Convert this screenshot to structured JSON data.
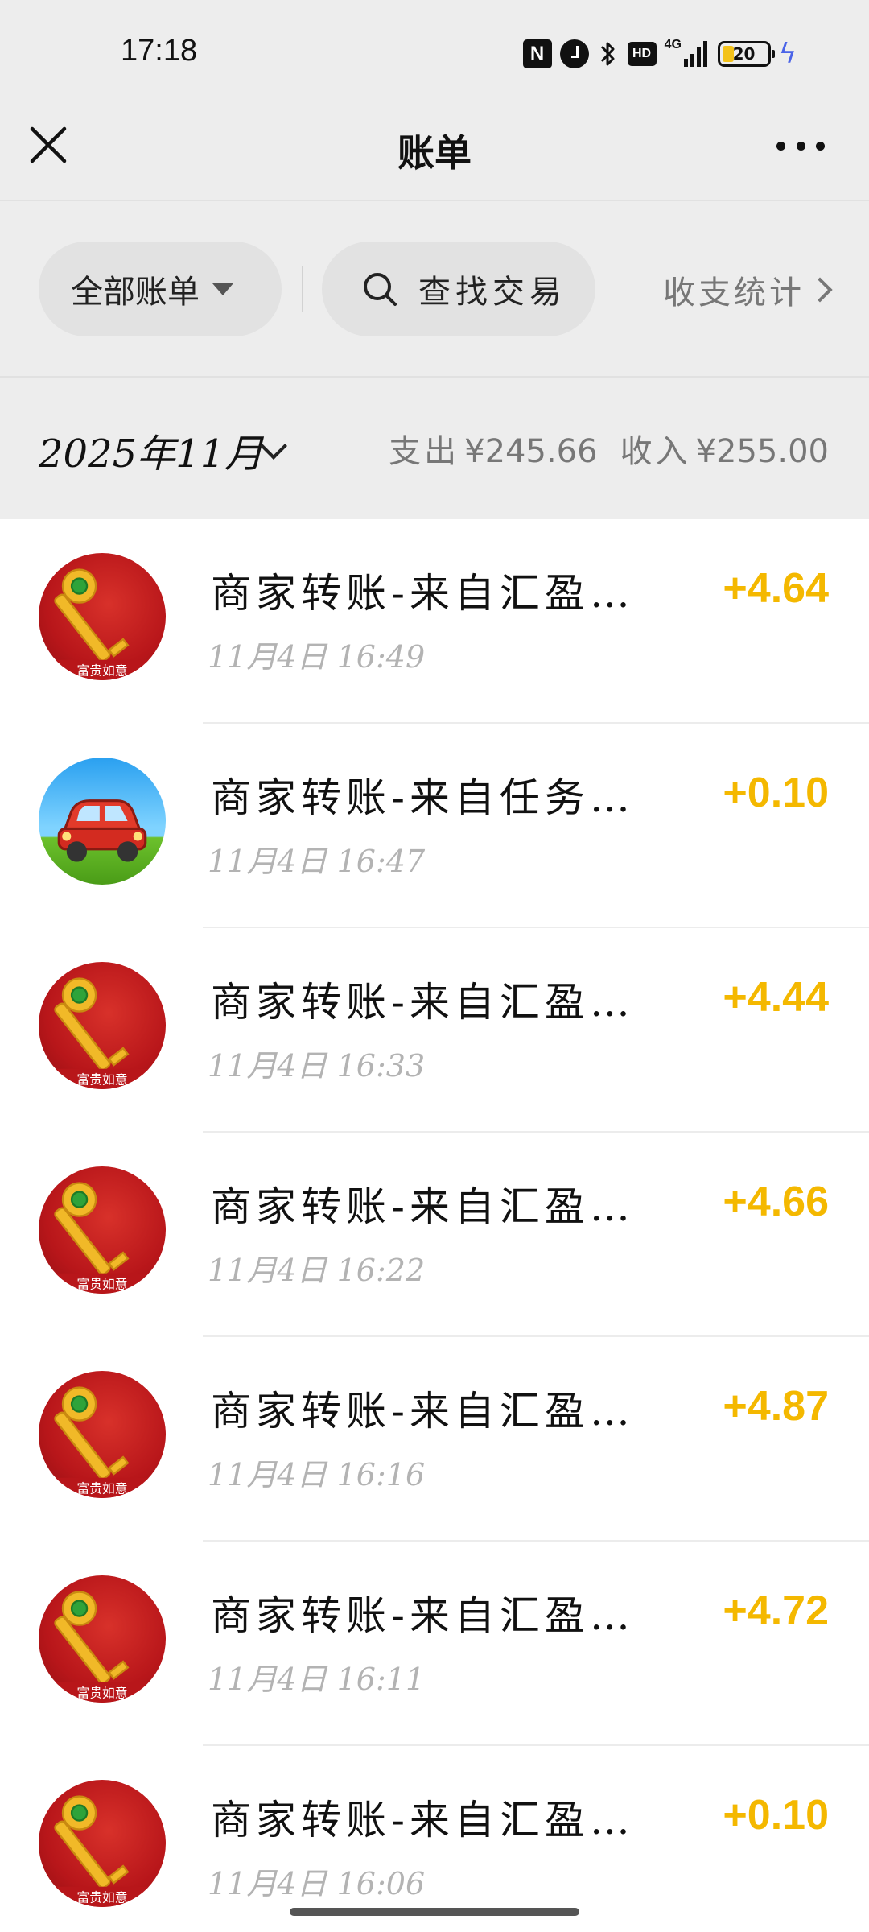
{
  "status_bar": {
    "time": "17:18",
    "icons": [
      "nfc-icon",
      "alarm-icon",
      "bluetooth-icon",
      "hd-icon",
      "4g-signal-icon",
      "battery-icon",
      "charging-icon"
    ],
    "network": "4G",
    "hd": "HD",
    "battery_level": "20"
  },
  "nav": {
    "title": "账单",
    "close_icon": "close-icon",
    "more_icon": "more-icon"
  },
  "filters": {
    "all_bills_label": "全部账单",
    "search_label": "查找交易",
    "stats_label": "收支统计"
  },
  "month": {
    "label": "2025年11月",
    "expense_label": "支出",
    "expense_value": "¥245.66",
    "income_label": "收入",
    "income_value": "¥255.00"
  },
  "colors": {
    "income_amount": "#f4b800",
    "header_bg": "#ededed",
    "charging_bolt": "#4a63e8"
  },
  "transactions": [
    {
      "title": "商家转账-来自汇盈…",
      "time": "11月4日 16:49",
      "amount": "+4.64",
      "avatar": "golden-key-avatar",
      "avatar_caption": "富贵如意"
    },
    {
      "title": "商家转账-来自任务…",
      "time": "11月4日 16:47",
      "amount": "+0.10",
      "avatar": "red-car-avatar"
    },
    {
      "title": "商家转账-来自汇盈…",
      "time": "11月4日 16:33",
      "amount": "+4.44",
      "avatar": "golden-key-avatar",
      "avatar_caption": "富贵如意"
    },
    {
      "title": "商家转账-来自汇盈…",
      "time": "11月4日 16:22",
      "amount": "+4.66",
      "avatar": "golden-key-avatar",
      "avatar_caption": "富贵如意"
    },
    {
      "title": "商家转账-来自汇盈…",
      "time": "11月4日 16:16",
      "amount": "+4.87",
      "avatar": "golden-key-avatar",
      "avatar_caption": "富贵如意"
    },
    {
      "title": "商家转账-来自汇盈…",
      "time": "11月4日 16:11",
      "amount": "+4.72",
      "avatar": "golden-key-avatar",
      "avatar_caption": "富贵如意"
    },
    {
      "title": "商家转账-来自汇盈…",
      "time": "11月4日 16:06",
      "amount": "+0.10",
      "avatar": "golden-key-avatar",
      "avatar_caption": "富贵如意"
    }
  ]
}
